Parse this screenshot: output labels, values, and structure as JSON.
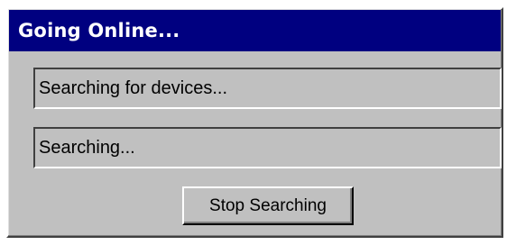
{
  "window": {
    "title": "Going Online..."
  },
  "status": {
    "primary": "Searching for devices...",
    "secondary": "Searching..."
  },
  "actions": {
    "stop_label": "Stop Searching"
  },
  "colors": {
    "title_bar": "#000080",
    "dialog_face": "#c0c0c0",
    "title_text": "#ffffff"
  }
}
